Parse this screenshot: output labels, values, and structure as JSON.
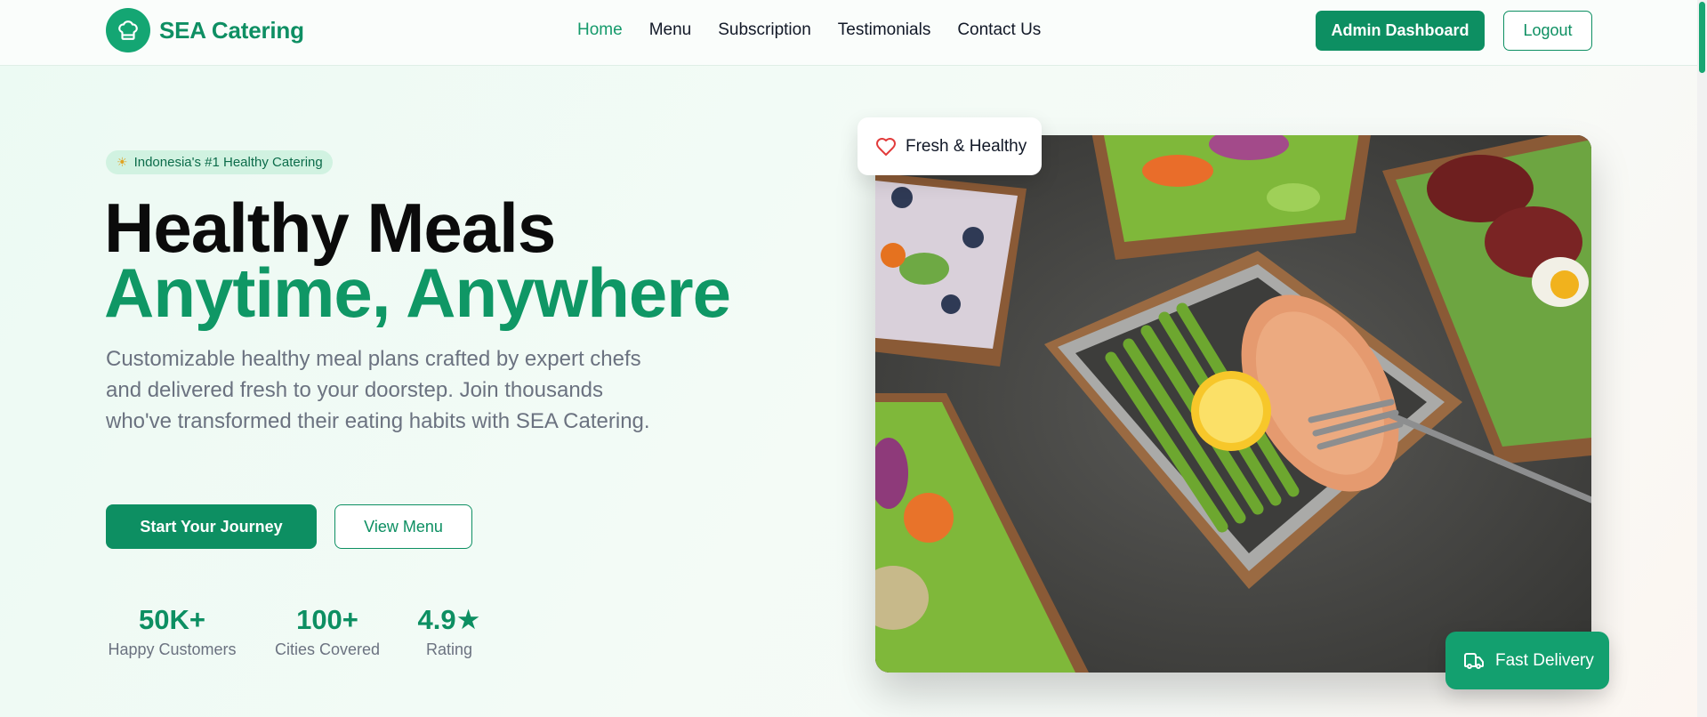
{
  "header": {
    "brand_name": "SEA Catering",
    "brand_icon": "chef-hat-icon",
    "nav": [
      {
        "label": "Home",
        "active": true
      },
      {
        "label": "Menu",
        "active": false
      },
      {
        "label": "Subscription",
        "active": false
      },
      {
        "label": "Testimonials",
        "active": false
      },
      {
        "label": "Contact Us",
        "active": false
      }
    ],
    "admin_button": "Admin Dashboard",
    "logout_button": "Logout"
  },
  "hero": {
    "badge": "Indonesia's #1 Healthy Catering",
    "badge_icon": "sun-icon",
    "title_line1": "Healthy Meals",
    "title_line2": "Anytime, Anywhere",
    "description": "Customizable healthy meal plans crafted by expert chefs and delivered fresh to your doorstep. Join thousands who've transformed their eating habits with SEA Catering.",
    "primary_button": "Start Your Journey",
    "secondary_button": "View Menu",
    "stats": [
      {
        "value": "50K+",
        "label": "Happy Customers"
      },
      {
        "value": "100+",
        "label": "Cities Covered"
      },
      {
        "value": "4.9★",
        "label": "Rating"
      }
    ],
    "image_card_top": "Fresh & Healthy",
    "image_card_top_icon": "heart-icon",
    "image_card_bottom": "Fast Delivery",
    "image_card_bottom_icon": "truck-icon"
  },
  "colors": {
    "primary": "#0d8f62",
    "accent_text": "#0f9765",
    "muted_text": "#6b7280",
    "badge_bg": "#d1f2e1"
  }
}
